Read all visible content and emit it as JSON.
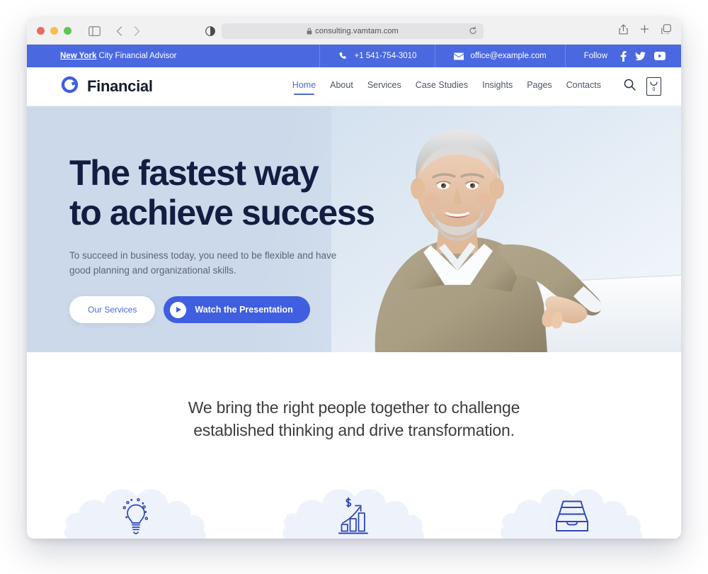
{
  "browser": {
    "url": "consulting.vamtam.com",
    "lock_icon": "lock-icon",
    "reload_icon": "reload-icon",
    "sidebar_icon": "sidebar-toggle-icon",
    "back_icon": "chevron-left-icon",
    "forward_icon": "chevron-right-icon",
    "contrast_icon": "contrast-icon",
    "share_icon": "share-icon",
    "newtab_icon": "plus-icon",
    "tabs_icon": "copy-tabs-icon"
  },
  "topbar": {
    "tagline_link": "New York",
    "tagline_rest": " City Financial Advisor",
    "phone": "+1 541-754-3010",
    "phone_icon": "phone-icon",
    "email": "office@example.com",
    "email_icon": "envelope-icon",
    "follow_label": "Follow",
    "socials": [
      {
        "name": "facebook-icon",
        "label": "f"
      },
      {
        "name": "twitter-icon",
        "label": "t"
      },
      {
        "name": "youtube-icon",
        "label": "y"
      }
    ],
    "bg_color": "#4a68e0"
  },
  "header": {
    "logo_icon": "circular-c-logo-icon",
    "brand": "Financial",
    "nav": [
      {
        "label": "Home",
        "active": true
      },
      {
        "label": "About",
        "active": false
      },
      {
        "label": "Services",
        "active": false
      },
      {
        "label": "Case Studies",
        "active": false
      },
      {
        "label": "Insights",
        "active": false
      },
      {
        "label": "Pages",
        "active": false
      },
      {
        "label": "Contacts",
        "active": false
      }
    ],
    "search_icon": "search-icon",
    "cart_icon": "cart-icon",
    "cart_count": "0",
    "accent_color": "#4a68e0"
  },
  "hero": {
    "title_line1": "The fastest way",
    "title_line2": "to achieve success",
    "subtitle_line1": "To succeed in business today, you need to be flexible and",
    "subtitle_line2": "have good planning and organizational skills.",
    "btn_secondary": "Our Services",
    "btn_primary": "Watch the Presentation",
    "play_icon": "play-icon",
    "bg_color": "#ccd9ea",
    "heading_color": "#141d41",
    "photo_alt": "smiling-businessman-leaning-on-white-surface"
  },
  "mid": {
    "heading_line1": "We bring the right people together to challenge",
    "heading_line2": "established thinking and drive transformation."
  },
  "features": [
    {
      "icon": "lightbulb-idea-icon"
    },
    {
      "icon": "growth-bar-chart-dollar-icon"
    },
    {
      "icon": "inbox-tray-icon"
    }
  ]
}
